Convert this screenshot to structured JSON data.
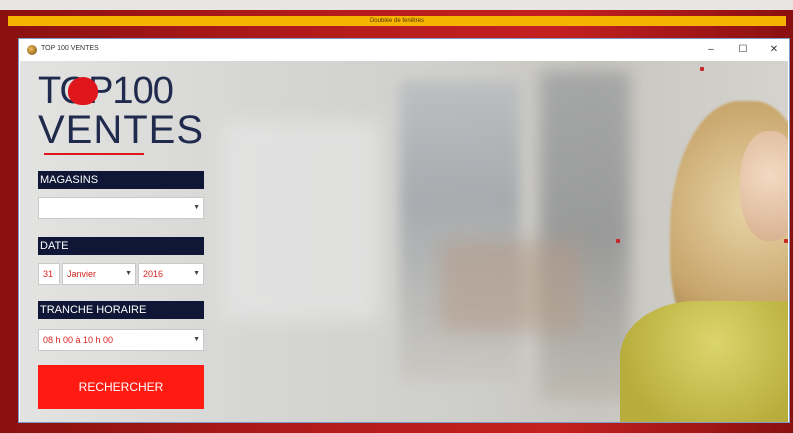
{
  "designer": {
    "bar_title": "Doublée de fenêtres"
  },
  "window": {
    "title": "TOP 100 VENTES",
    "minimize": "–",
    "maximize": "☐",
    "close": "✕"
  },
  "logo": {
    "line1": "TOP100",
    "line2": "VENTES"
  },
  "form": {
    "magasins": {
      "label": "MAGASINS",
      "value": ""
    },
    "date": {
      "label": "DATE",
      "day": "31",
      "month": "Janvier",
      "year": "2016"
    },
    "tranche": {
      "label": "TRANCHE HORAIRE",
      "value": "08 h 00 à 10 h 00"
    },
    "search_button": "RECHERCHER"
  },
  "colors": {
    "accent": "#ff1a12",
    "navy": "#0f1636",
    "designer_bar": "#f5b400"
  }
}
